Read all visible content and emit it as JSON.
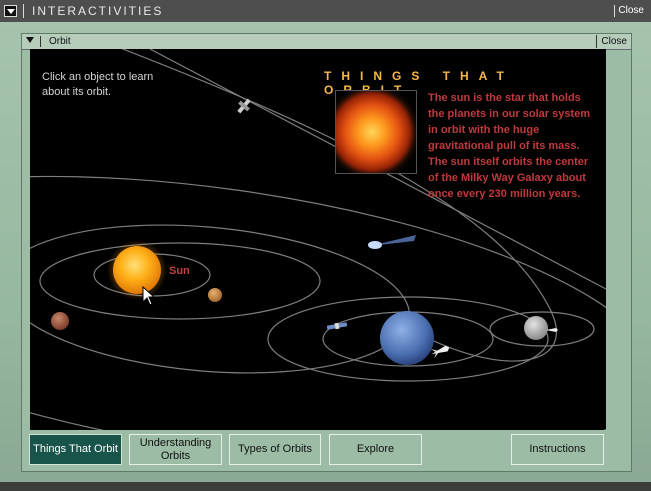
{
  "outer_window": {
    "title": "INTERACTIVITIES",
    "close_label": "Close"
  },
  "inner_window": {
    "title": "Orbit",
    "close_label": "Close"
  },
  "stage": {
    "instruction": "Click an object to learn about its orbit.",
    "heading": "THINGS THAT ORBIT",
    "info": "The sun is the star that holds the planets in our solar system in orbit with the huge gravitational pull of its mass. The sun itself orbits the center of the Milky Way Galaxy about once every 230 million years.",
    "sun_label": "Sun"
  },
  "nav": {
    "buttons": [
      {
        "label": "Things That Orbit",
        "active": true
      },
      {
        "label": "Understanding Orbits",
        "active": false
      },
      {
        "label": "Types of Orbits",
        "active": false
      },
      {
        "label": "Explore",
        "active": false
      },
      {
        "label": "Instructions",
        "active": false
      }
    ]
  },
  "colors": {
    "heading": "#f6b84a",
    "info_text": "#c13a3a",
    "panel_green": "#9dbca5",
    "active_button": "#19544a"
  },
  "icons": [
    "menu-arrow-icon",
    "satellite-icon",
    "comet-icon",
    "space-shuttle-icon",
    "mouse-cursor-icon"
  ]
}
